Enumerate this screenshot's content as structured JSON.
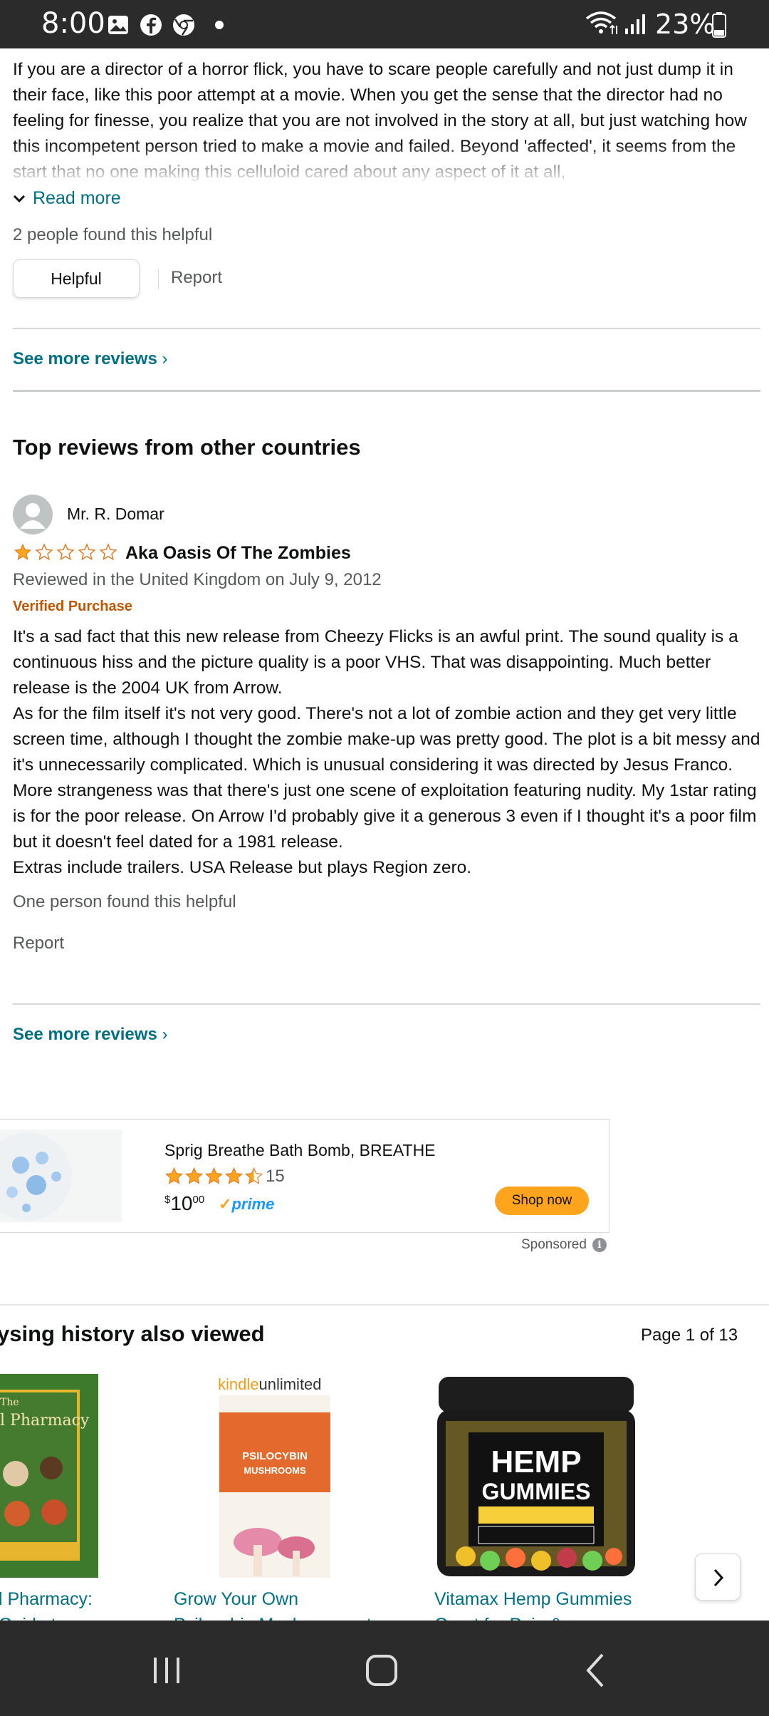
{
  "status_bar": {
    "time": "8:00",
    "battery": "23%"
  },
  "review_prev": {
    "body": "If you are a director of a horror flick, you have to scare people carefully and not just dump it in their face, like this poor attempt at a movie. When you get the sense that the director had no feeling for finesse, you realize that you are not involved in the story at all, but just watching how this incompetent person tried to make a movie and failed. Beyond 'affected', it seems from the start that no one making this celluloid cared about any aspect of it at all,",
    "read_more": "Read more",
    "helpful_count": "2 people found this helpful",
    "helpful_button": "Helpful",
    "report": "Report"
  },
  "see_more_1": "See more reviews",
  "section_title": "Top reviews from other countries",
  "review": {
    "reviewer": "Mr. R. Domar",
    "rating": 1,
    "max_rating": 5,
    "title": "Aka Oasis Of The Zombies",
    "reviewed_in": "Reviewed in the United Kingdom on July 9, 2012",
    "verified": "Verified Purchase",
    "body": [
      "It's a sad fact that this new release from Cheezy Flicks is an awful print. The sound quality is a continuous hiss and the picture quality is a poor VHS. That was disappointing. Much better release is the 2004 UK from Arrow.",
      "As for the film itself it's not very good. There's not a lot of zombie action and they get very little screen time, although I thought the zombie make-up was pretty good. The plot is a bit messy and it's unnecessarily complicated. Which is unusual considering it was directed by Jesus Franco. More strangeness was that there's just one scene of exploitation featuring nudity. My 1star rating is for the poor release. On Arrow I'd probably give it a generous 3 even if I thought it's a poor film but it doesn't feel dated for a 1981 release.",
      "Extras include trailers. USA Release but plays Region zero."
    ],
    "helpful_count": "One person found this helpful",
    "report": "Report"
  },
  "see_more_2": "See more reviews",
  "ad": {
    "title": "Sprig Breathe Bath Bomb, BREATHE",
    "rating": 4.5,
    "rating_count": "15",
    "price_currency": "$",
    "price_whole": "10",
    "price_fraction": "00",
    "prime": "prime",
    "shop_button": "Shop now",
    "sponsored": "Sponsored"
  },
  "browsing_history": {
    "title": "ysing history also viewed",
    "page_indicator": "Page 1 of 13",
    "items": [
      {
        "label_line1": "l Pharmacy:",
        "label_line2": "Guide to",
        "cover_text": "The Pharmacy"
      },
      {
        "label_line1": "Grow Your Own",
        "label_line2": "Psilocybin Mushrooms at",
        "cover_brand": "kindleunlimited",
        "cover_text": "GROW YOUR OWN PSILOCYBIN MUSHROOMS AT HOME"
      },
      {
        "label_line1": "Vitamax Hemp Gummies",
        "label_line2": "Great for Pain &",
        "cover_text": "HEMP GUMMIES"
      }
    ]
  },
  "colors": {
    "link": "#007185",
    "accent_orange": "#ffa41c",
    "verified": "#c45500",
    "star": "#ffa41c"
  }
}
